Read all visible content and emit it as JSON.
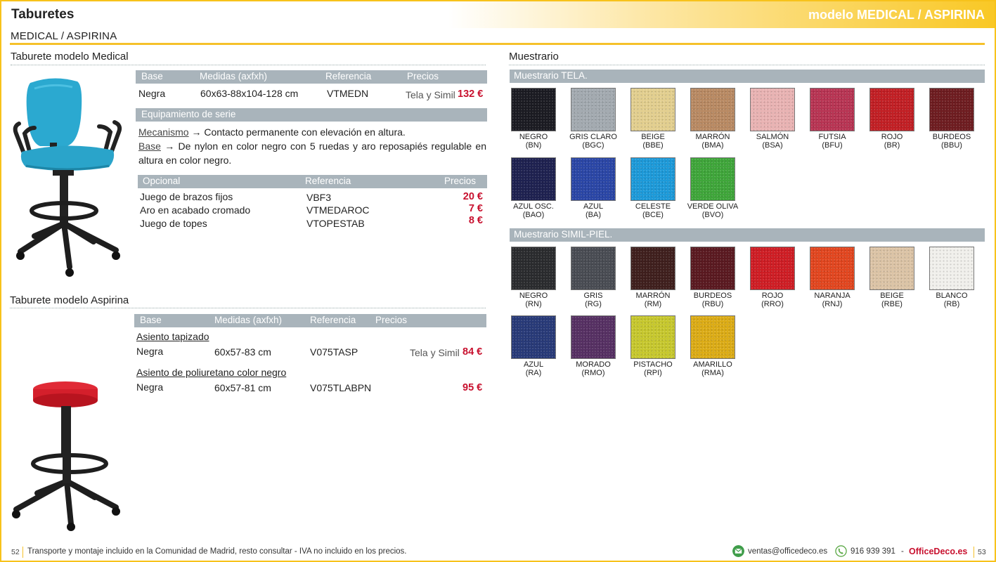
{
  "header": {
    "title": "Taburetes",
    "model": "modelo MEDICAL / ASPIRINA"
  },
  "subtitle": "MEDICAL / ASPIRINA",
  "medical": {
    "title": "Taburete modelo Medical",
    "table_headers": [
      "Base",
      "Medidas (axfxh)",
      "Referencia",
      "Precios"
    ],
    "row": {
      "base": "Negra",
      "medidas": "60x63-88x104-128 cm",
      "referencia": "VTMEDN",
      "precio_label": "Tela y Simil",
      "precio": "132 €"
    },
    "equipamiento_title": "Equipamiento de serie",
    "mecanismo_label": "Mecanismo",
    "mecanismo_text": " → Contacto permanente con elevación en altura.",
    "base_label": "Base",
    "base_text": " → De nylon en color negro con 5 ruedas y aro reposapiés regulable en altura en color negro.",
    "opcional_headers": [
      "Opcional",
      "Referencia",
      "Precios"
    ],
    "opcionales": [
      {
        "name": "Juego de brazos fijos",
        "ref": "VBF3",
        "price": "20 €"
      },
      {
        "name": "Aro en acabado cromado",
        "ref": "VTMEDAROC",
        "price": "7 €"
      },
      {
        "name": "Juego de topes",
        "ref": "VTOPESTAB",
        "price": "8 €"
      }
    ]
  },
  "aspirina": {
    "title": "Taburete modelo Aspirina",
    "table_headers": [
      "Base",
      "Medidas (axfxh)",
      "Referencia",
      "Precios"
    ],
    "group1_title": "Asiento tapizado",
    "row1": {
      "base": "Negra",
      "medidas": "60x57-83 cm",
      "referencia": "V075TASP",
      "precio_label": "Tela y Simil",
      "precio": "84 €"
    },
    "group2_title": "Asiento de poliuretano color negro",
    "row2": {
      "base": "Negra",
      "medidas": "60x57-81 cm",
      "referencia": "V075TLABPN",
      "precio": "95 €"
    }
  },
  "muestrario": {
    "title": "Muestrario",
    "tela_title": "Muestrario TELA.",
    "tela": [
      {
        "name": "NEGRO",
        "code": "(BN)",
        "color": "#1b1b22"
      },
      {
        "name": "GRIS CLARO",
        "code": "(BGC)",
        "color": "#a3aab0"
      },
      {
        "name": "BEIGE",
        "code": "(BBE)",
        "color": "#e3cf8f"
      },
      {
        "name": "MARRÓN",
        "code": "(BMA)",
        "color": "#b98a63"
      },
      {
        "name": "SALMÓN",
        "code": "(BSA)",
        "color": "#e9b3b3"
      },
      {
        "name": "FUTSIA",
        "code": "(BFU)",
        "color": "#b83453"
      },
      {
        "name": "ROJO",
        "code": "(BR)",
        "color": "#c21f24"
      },
      {
        "name": "BURDEOS",
        "code": "(BBU)",
        "color": "#6e1c20"
      },
      {
        "name": "AZUL OSC.",
        "code": "(BAO)",
        "color": "#1e2150"
      },
      {
        "name": "AZUL",
        "code": "(BA)",
        "color": "#2a46a6"
      },
      {
        "name": "CELESTE",
        "code": "(BCE)",
        "color": "#1d9ad9"
      },
      {
        "name": "VERDE OLIVA",
        "code": "(BVO)",
        "color": "#3fa63a"
      }
    ],
    "simil_title": "Muestrario SIMIL-PIEL.",
    "simil": [
      {
        "name": "NEGRO",
        "code": "(RN)",
        "color": "#2a2b2e"
      },
      {
        "name": "GRIS",
        "code": "(RG)",
        "color": "#494c53"
      },
      {
        "name": "MARRÓN",
        "code": "(RM)",
        "color": "#3f1f1d"
      },
      {
        "name": "BURDEOS",
        "code": "(RBU)",
        "color": "#5a1920"
      },
      {
        "name": "ROJO",
        "code": "(RRO)",
        "color": "#cf1d24"
      },
      {
        "name": "NARANJA",
        "code": "(RNJ)",
        "color": "#e2461f"
      },
      {
        "name": "BEIGE",
        "code": "(RBE)",
        "color": "#dcc4a6"
      },
      {
        "name": "BLANCO",
        "code": "(RB)",
        "color": "#f1f0ec"
      },
      {
        "name": "AZUL",
        "code": "(RA)",
        "color": "#283a78"
      },
      {
        "name": "MORADO",
        "code": "(RMO)",
        "color": "#563063"
      },
      {
        "name": "PISTACHO",
        "code": "(RPI)",
        "color": "#c7c82e"
      },
      {
        "name": "AMARILLO",
        "code": "(RMA)",
        "color": "#dcac16"
      }
    ]
  },
  "footer": {
    "page_left": "52",
    "note": "Transporte y montaje incluido en la Comunidad de Madrid, resto consultar - IVA no incluido en los precios.",
    "email": "ventas@officedeco.es",
    "phone": "916 939 391",
    "dash": "-",
    "brand": "OfficeDeco.es",
    "page_right": "53"
  },
  "colors": {
    "accent": "#f5c12a",
    "price": "#c8102e",
    "bar": "#a9b4bb"
  },
  "icons": [
    "chair-medical-image",
    "stool-aspirina-image",
    "email-icon",
    "phone-icon"
  ]
}
